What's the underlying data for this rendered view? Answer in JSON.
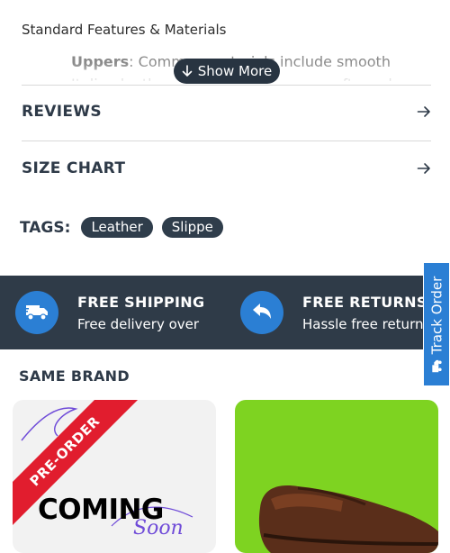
{
  "features": {
    "heading": "Standard Features & Materials",
    "item_label": "Uppers",
    "item_text": ": Common materials include smooth Italian leather, textured leather, or soft suede",
    "show_more": "Show More"
  },
  "sections": {
    "reviews": "REVIEWS",
    "size_chart": "SIZE CHART"
  },
  "tags": {
    "label": "TAGS:",
    "items": [
      "Leather",
      "Slippe"
    ]
  },
  "shipping": {
    "free_shipping_title": "FREE SHIPPING",
    "free_shipping_sub": "Free delivery over",
    "free_returns_title": "FREE RETURNS",
    "free_returns_sub": "Hassle free return"
  },
  "track_order": "Track Order",
  "same_brand": {
    "title": "SAME BRAND",
    "card1_badge": "PRE-ORDER",
    "card1_coming": "COMING",
    "card1_soon": "Soon"
  },
  "colors": {
    "dark": "#2f3b48",
    "accent_blue": "#2b7fd4",
    "badge_red": "#e11d2e",
    "product_bg": "#7ed321"
  },
  "icons": [
    "arrow-down-icon",
    "arrow-right-icon",
    "truck-icon",
    "return-icon"
  ]
}
